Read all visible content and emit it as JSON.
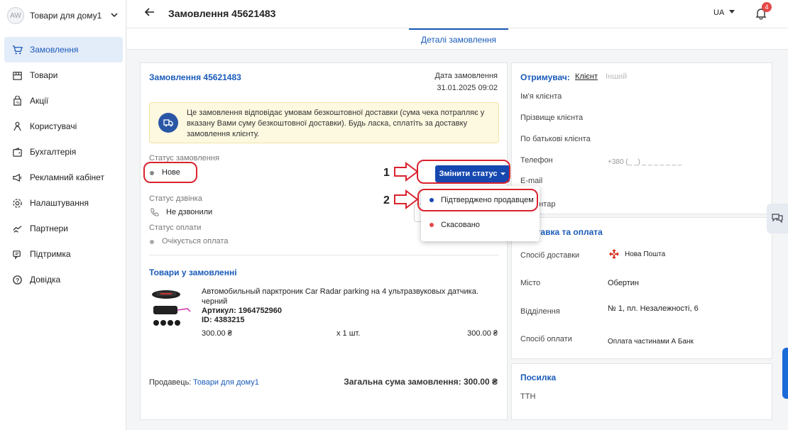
{
  "sidebar": {
    "avatar": "AW",
    "shop_name": "Товари для дому1",
    "items": [
      {
        "label": "Замовлення",
        "icon": "cart-icon"
      },
      {
        "label": "Товари",
        "icon": "store-icon"
      },
      {
        "label": "Акції",
        "icon": "promo-icon"
      },
      {
        "label": "Користувачі",
        "icon": "users-icon"
      },
      {
        "label": "Бухгалтерія",
        "icon": "wallet-icon"
      },
      {
        "label": "Рекламний кабінет",
        "icon": "megaphone-icon"
      },
      {
        "label": "Налаштування",
        "icon": "gear-icon"
      },
      {
        "label": "Партнери",
        "icon": "handshake-icon"
      },
      {
        "label": "Підтримка",
        "icon": "support-icon"
      },
      {
        "label": "Довідка",
        "icon": "help-icon"
      }
    ]
  },
  "header": {
    "title": "Замовлення 45621483",
    "lang": "UA",
    "notifications": "4"
  },
  "tabs": {
    "active": "Деталі замовлення"
  },
  "order": {
    "title": "Замовлення 45621483",
    "date_label": "Дата замовлення",
    "date_value": "31.01.2025 09:02",
    "notice": "Це замовлення відповідає умовам безкоштовної доставки (сума чека потрапляє у вказану Вами суму безкоштовної доставки). Будь ласка, сплатіть за доставку замовлення клієнту.",
    "status_label": "Статус замовлення",
    "status_value": "Нове",
    "call_label": "Статус дзвінка",
    "call_value": "Не дзвонили",
    "pay_label": "Статус оплати",
    "pay_value": "Очікується оплата",
    "change_button": "Змінити статус",
    "goods_title": "Товари у замовленні",
    "product": {
      "name": "Автомобильный парктроник Car Radar parking на 4 ультразвуковых датчика. черний",
      "article": "Артикул: 1964752960",
      "id": "ID: 4383215",
      "price": "300.00 ₴",
      "qty": "х 1 шт.",
      "sum": "300.00 ₴"
    },
    "seller_label": "Продавець:",
    "seller_name": "Товари для дому1",
    "total": "Загальна сума замовлення: 300.00 ₴"
  },
  "dropdown": {
    "items": [
      {
        "label": "Підтверджено продавцем",
        "color": "#1648b0"
      },
      {
        "label": "Скасовано",
        "color": "#e64848"
      }
    ]
  },
  "recipient": {
    "title": "Отримувач:",
    "tab_client": "Клієнт",
    "tab_other": "Інший",
    "first_name": "Ім'я клієнта",
    "last_name": "Прізвище клієнта",
    "middle_name": "По батькові клієнта",
    "phone_label": "Телефон",
    "phone_value": "+380 (_ _) _ _ _ _ _ _ _",
    "email_label": "E-mail",
    "comment_label": "Коментар"
  },
  "delivery": {
    "title": "Доставка та оплата",
    "method_label": "Спосіб доставки",
    "method_value": "Нова Пошта",
    "city_label": "Місто",
    "city_value": "Обертин",
    "branch_label": "Відділення",
    "branch_value": "№ 1, пл. Незалежності, 6",
    "pay_label": "Спосіб оплати",
    "pay_value": "Оплата частинами А Банк"
  },
  "parcel": {
    "title": "Посилка",
    "ttn_label": "ТТН"
  },
  "annotations": {
    "one": "1",
    "two": "2"
  }
}
